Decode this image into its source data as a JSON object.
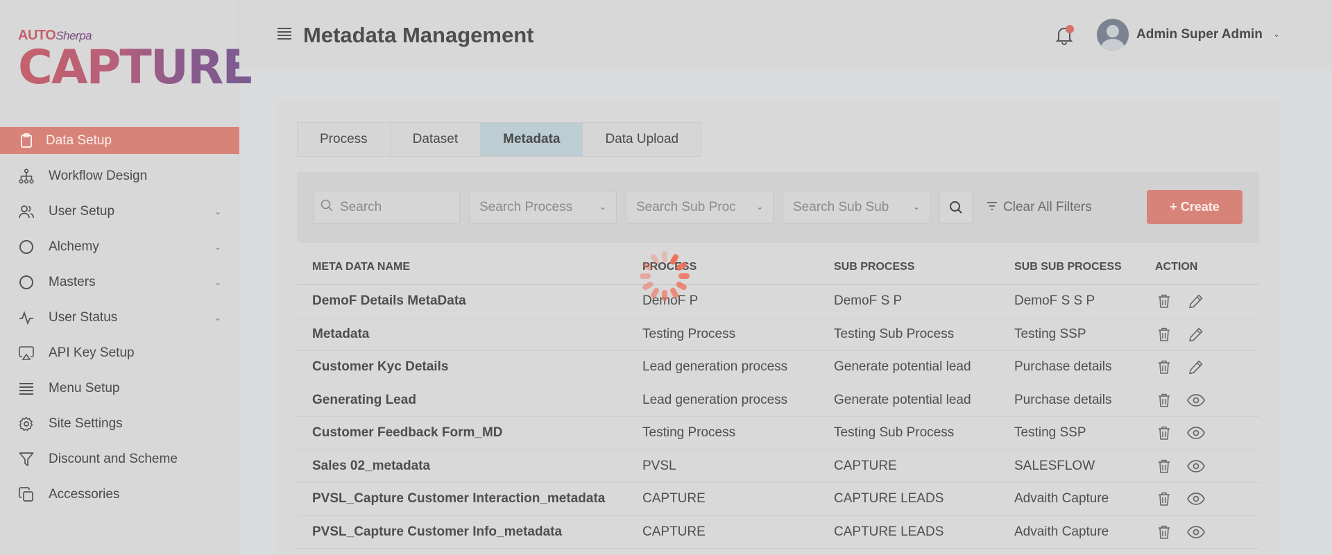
{
  "brand": {
    "small_auto": "AUTO",
    "small_sherpa": "Sherpa",
    "big": "CAPTURE"
  },
  "sidebar": {
    "items": [
      {
        "label": "Data Setup",
        "icon": "clipboard-icon",
        "active": true,
        "chevron": false
      },
      {
        "label": "Workflow Design",
        "icon": "hierarchy-icon",
        "chevron": false
      },
      {
        "label": "User Setup",
        "icon": "users-icon",
        "chevron": true
      },
      {
        "label": "Alchemy",
        "icon": "circle-icon",
        "chevron": true
      },
      {
        "label": "Masters",
        "icon": "circle-icon",
        "chevron": true
      },
      {
        "label": "User Status",
        "icon": "activity-icon",
        "chevron": true
      },
      {
        "label": "API Key Setup",
        "icon": "airplay-icon",
        "chevron": false
      },
      {
        "label": "Menu Setup",
        "icon": "menu-lines-icon",
        "chevron": false
      },
      {
        "label": "Site Settings",
        "icon": "gear-icon",
        "chevron": false
      },
      {
        "label": "Discount and Scheme",
        "icon": "filter-icon",
        "chevron": false
      },
      {
        "label": "Accessories",
        "icon": "copy-icon",
        "chevron": false
      }
    ]
  },
  "header": {
    "title": "Metadata Management",
    "username": "Admin Super Admin"
  },
  "tabs": [
    {
      "label": "Process",
      "active": false
    },
    {
      "label": "Dataset",
      "active": false
    },
    {
      "label": "Metadata",
      "active": true
    },
    {
      "label": "Data Upload",
      "active": false
    }
  ],
  "filters": {
    "search_placeholder": "Search",
    "process_placeholder": "Search Process",
    "sub_process_placeholder": "Search Sub Proc",
    "sub_sub_process_placeholder": "Search Sub Sub",
    "clear_label": "Clear All Filters",
    "create_label": "+ Create"
  },
  "table": {
    "headers": [
      "META DATA NAME",
      "PROCESS",
      "SUB PROCESS",
      "SUB SUB PROCESS",
      "ACTION"
    ],
    "rows": [
      {
        "name": "DemoF Details MetaData",
        "process": "DemoF P",
        "sub": "DemoF S P",
        "subsub": "DemoF S S P",
        "second_action": "edit"
      },
      {
        "name": "Metadata",
        "process": "Testing Process",
        "sub": "Testing Sub Process",
        "subsub": "Testing SSP",
        "second_action": "edit"
      },
      {
        "name": "Customer Kyc Details",
        "process": "Lead generation process",
        "sub": "Generate potential lead",
        "subsub": "Purchase details",
        "second_action": "edit"
      },
      {
        "name": "Generating Lead",
        "process": "Lead generation process",
        "sub": "Generate potential lead",
        "subsub": "Purchase details",
        "second_action": "view"
      },
      {
        "name": "Customer Feedback Form_MD",
        "process": "Testing Process",
        "sub": "Testing Sub Process",
        "subsub": "Testing SSP",
        "second_action": "view"
      },
      {
        "name": "Sales 02_metadata",
        "process": "PVSL",
        "sub": "CAPTURE",
        "subsub": "SALESFLOW",
        "second_action": "view"
      },
      {
        "name": "PVSL_Capture Customer Interaction_metadata",
        "process": "CAPTURE",
        "sub": "CAPTURE LEADS",
        "subsub": "Advaith Capture",
        "second_action": "view"
      },
      {
        "name": "PVSL_Capture Customer Info_metadata",
        "process": "CAPTURE",
        "sub": "CAPTURE LEADS",
        "subsub": "Advaith Capture",
        "second_action": "view"
      }
    ]
  },
  "colors": {
    "accent": "#d8837a",
    "tab_active": "#bccdd3",
    "spinner": "#f06a55"
  }
}
